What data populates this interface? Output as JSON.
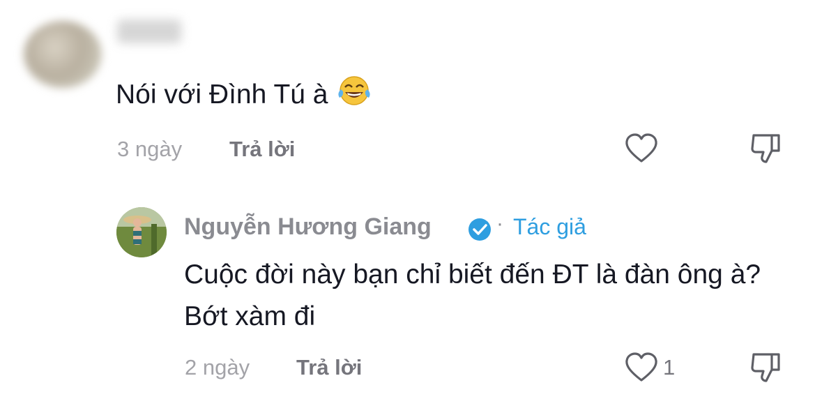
{
  "comments": [
    {
      "text": "Nói với Đình Tú à",
      "time": "3 ngày",
      "reply_label": "Trả lời"
    }
  ],
  "reply": {
    "author_name": "Nguyễn Hương Giang",
    "author_badge": "Tác giả",
    "text": "Cuộc đời này bạn chỉ biết đến ĐT là đàn ông à? Bớt xàm đi",
    "time": "2 ngày",
    "reply_label": "Trả lời",
    "likes": "1"
  },
  "icons": {
    "emoji": "tears-of-joy-emoji",
    "like": "heart-outline-icon",
    "dislike": "thumbs-down-icon",
    "verified": "verified-badge-icon"
  },
  "colors": {
    "text": "#161823",
    "muted": "#a3a3a8",
    "link": "#2e9ee0"
  }
}
